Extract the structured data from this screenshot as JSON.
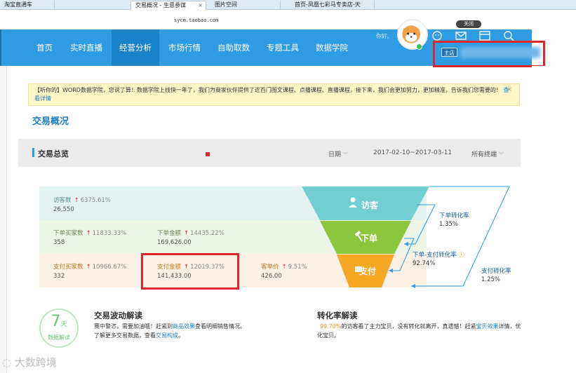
{
  "browser": {
    "tabs": [
      "淘宝直通车",
      "交易概况 - 生意参谋",
      "图片空间",
      "首页-凤凰七彩马专卖店-天"
    ],
    "url": "sycm.taobao.com",
    "close_tip": "关闭"
  },
  "nav": {
    "items": [
      "首页",
      "实时直播",
      "经营分析",
      "市场行情",
      "自助取数",
      "专题工具",
      "数据学院"
    ],
    "active": "经营分析",
    "greeting": "你好,",
    "store_badge": "主店"
  },
  "notice": {
    "text": "【听你的】WORD数据学院，您说了算！数据学院上线快一年了，我们为商家伙伴提供了近百门图文课程、点播课程、直播课程，接下来，我们会更加努力，更加精准，告诉我们您需要的！",
    "link": "查看详情",
    "close": "×"
  },
  "page_title": "交易概况",
  "overview": {
    "title": "交易总览",
    "date_label": "日期",
    "date_range": "2017-02-10~2017-03-11",
    "terminal": "所有终端"
  },
  "metrics": {
    "visitors": {
      "label": "访客数",
      "pct": "6375.61%",
      "value": "26,550"
    },
    "order_buyers": {
      "label": "下单买家数",
      "pct": "11833.33%",
      "value": "358"
    },
    "order_amount": {
      "label": "下单金额",
      "pct": "14435.22%",
      "value": "169,626.00"
    },
    "pay_buyers": {
      "label": "支付买家数",
      "pct": "10966.67%",
      "value": "332"
    },
    "pay_amount": {
      "label": "支付金额",
      "pct": "12019.37%",
      "value": "141,433.00"
    },
    "unit_price": {
      "label": "客单价",
      "pct": "9.51%",
      "value": "426.00"
    }
  },
  "funnel": {
    "stage1": "访客",
    "stage2": "下单",
    "stage3": "支付",
    "order_rate_label": "下单转化率",
    "order_rate": "1.35%",
    "order_pay_rate_label": "下单-支付转化率",
    "order_pay_rate": "92.74%",
    "pay_rate_label": "支付转化率",
    "pay_rate": "1.25%"
  },
  "analysis": {
    "circle_number": "7",
    "circle_unit": "天",
    "circle_label": "数据解读",
    "fluct_title": "交易波动解读",
    "fluct_line1_a": "赛中警恣，需要加油哦！赶紧到",
    "fluct_line1_link": "商品效果",
    "fluct_line1_b": "查看明细销售情况。",
    "fluct_line2_a": "了解更多交易数据，查看",
    "fluct_line2_link": "交易构成",
    "fluct_line2_b": "。",
    "conv_title": "转化率解读",
    "conv_pct": "99.70%",
    "conv_text_a": "的访客看了主力宝贝，没有转化就离开，真遗憾！赶紧",
    "conv_link": "宝贝效果",
    "conv_text_b": "详情，优化宝贝。"
  },
  "watermark": "大数跨境"
}
